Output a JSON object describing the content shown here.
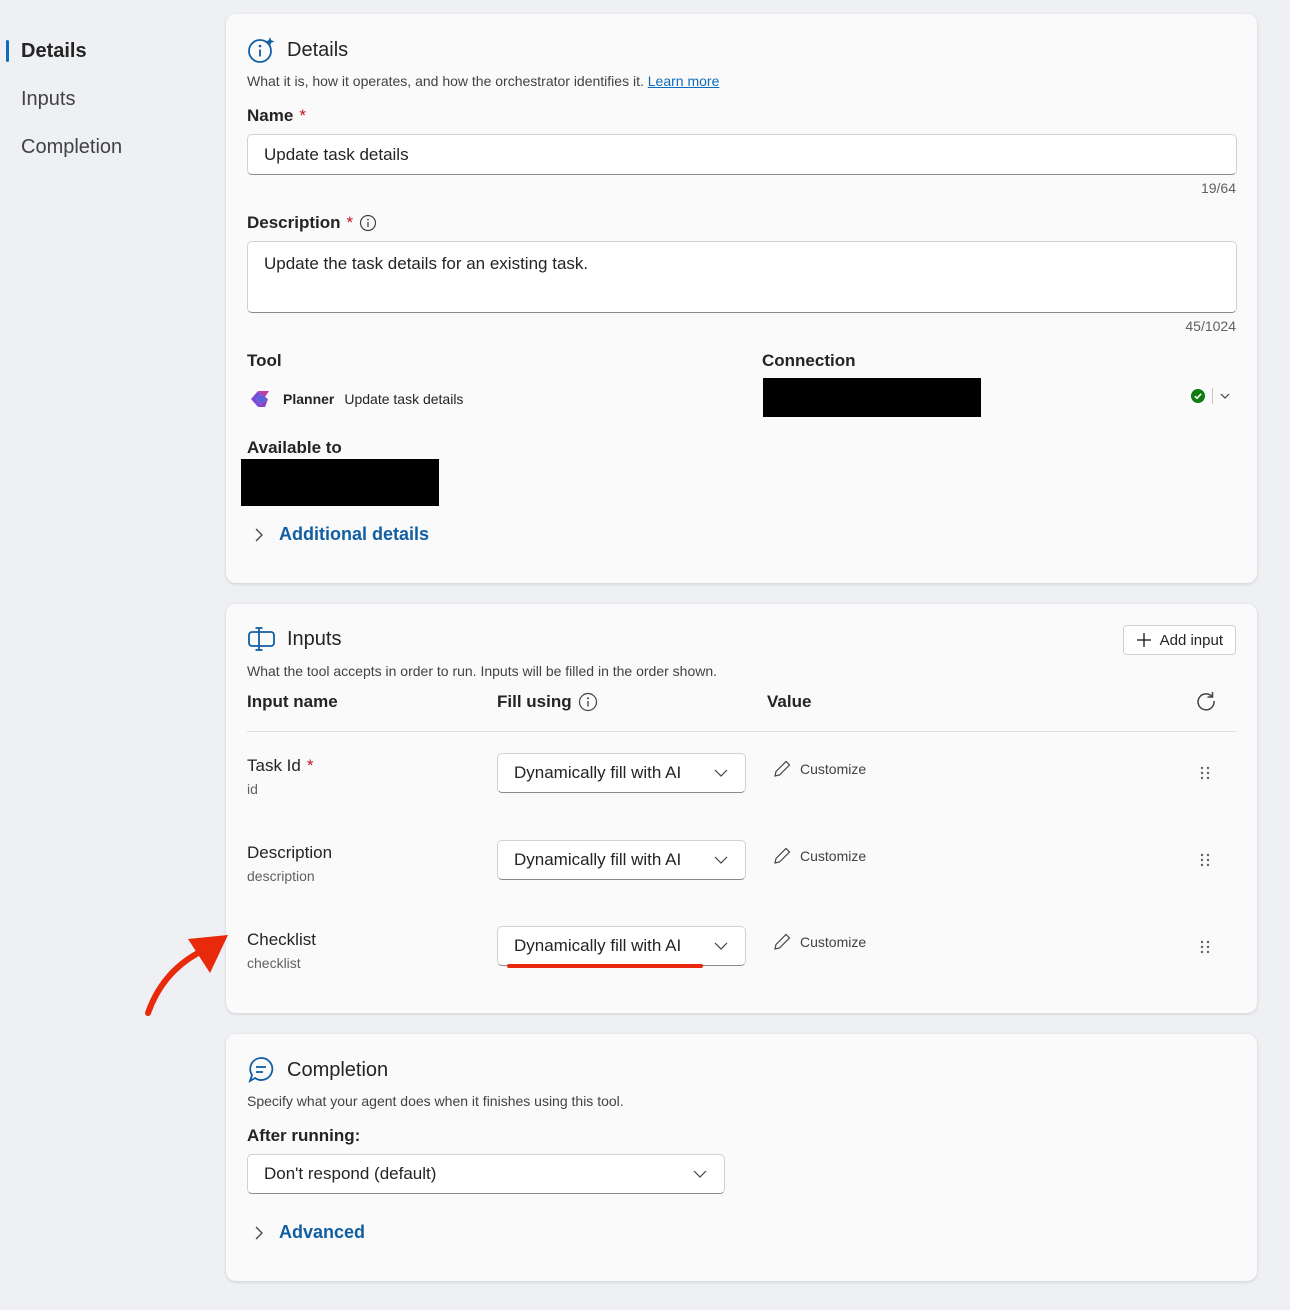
{
  "nav": {
    "items": [
      "Details",
      "Inputs",
      "Completion"
    ]
  },
  "details": {
    "title": "Details",
    "subtitle": "What it is, how it operates, and how the orchestrator identifies it.",
    "learn_more": "Learn more",
    "name_label": "Name",
    "required_mark": "*",
    "name_value": "Update task details",
    "name_counter": "19/64",
    "description_label": "Description",
    "description_value": "Update the task details for an existing task.",
    "description_counter": "45/1024",
    "tool_label": "Tool",
    "tool_app": "Planner",
    "tool_action": "Update task details",
    "connection_label": "Connection",
    "available_label": "Available to",
    "additional_details": "Additional details"
  },
  "inputs": {
    "title": "Inputs",
    "subtitle": "What the tool accepts in order to run. Inputs will be filled in the order shown.",
    "add_input": "Add input",
    "col_name": "Input name",
    "col_fill": "Fill using",
    "col_value": "Value",
    "rows": [
      {
        "name": "Task Id",
        "sub": "id",
        "required": "*",
        "fill": "Dynamically fill with AI",
        "value_action": "Customize"
      },
      {
        "name": "Description",
        "sub": "description",
        "required": "",
        "fill": "Dynamically fill with AI",
        "value_action": "Customize"
      },
      {
        "name": "Checklist",
        "sub": "checklist",
        "required": "",
        "fill": "Dynamically fill with AI",
        "value_action": "Customize"
      }
    ]
  },
  "completion": {
    "title": "Completion",
    "subtitle": "Specify what your agent does when it finishes using this tool.",
    "after_label": "After running:",
    "after_value": "Don't respond (default)",
    "advanced": "Advanced"
  },
  "colors": {
    "accent": "#0f6cbd",
    "link": "#115ea3",
    "annotation_red": "#e8290b",
    "status_green": "#107c10"
  },
  "icons": [
    "info-sparkle-icon",
    "info-icon",
    "planner-icon",
    "status-check-icon",
    "chevron-down-icon",
    "chevron-right-icon",
    "input-icon",
    "add-icon",
    "refresh-icon",
    "pencil-icon",
    "drag-handle-icon",
    "chat-icon"
  ]
}
